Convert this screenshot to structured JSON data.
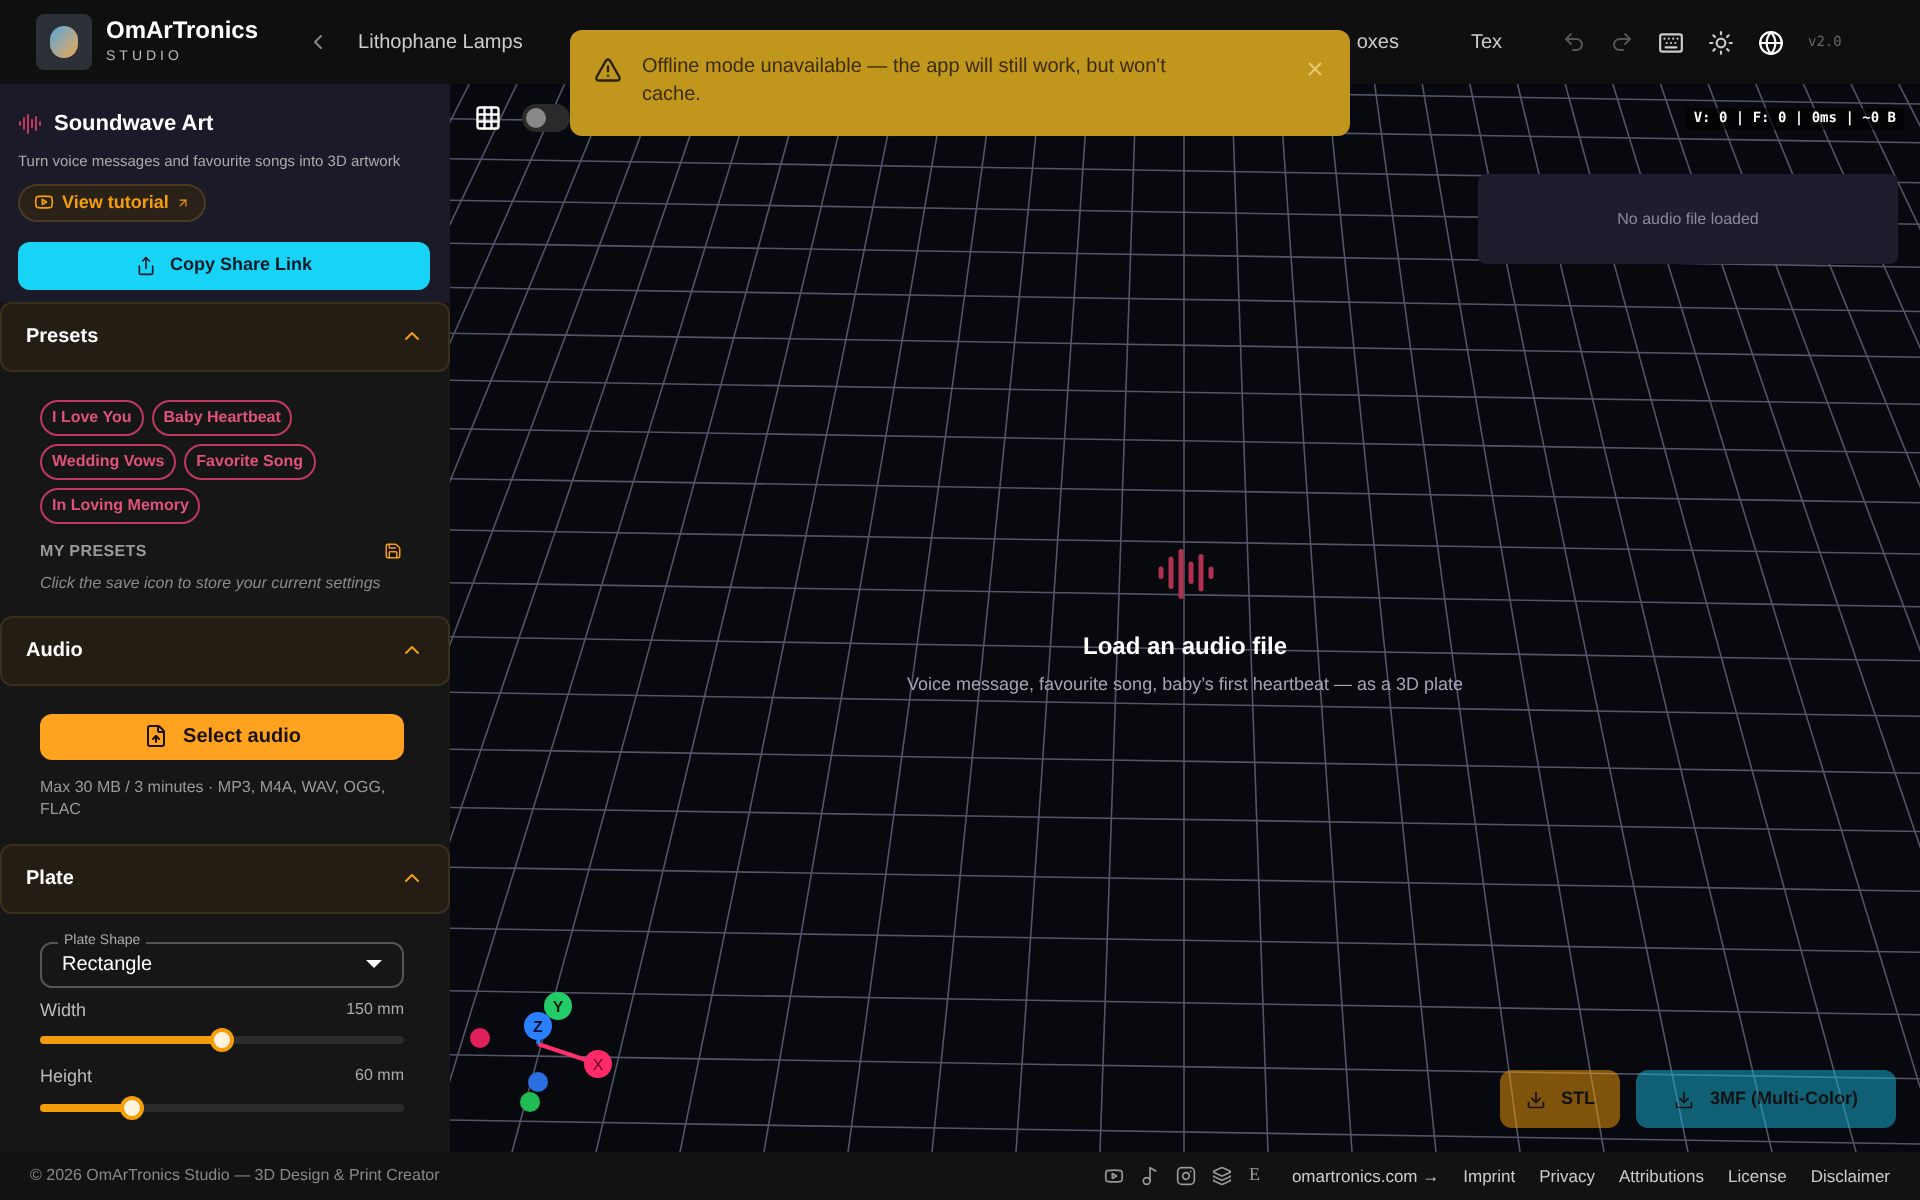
{
  "brand": {
    "name": "OmArTronics",
    "sub": "STUDIO"
  },
  "nav": {
    "tabs": [
      {
        "label": "Lithophane Lamps",
        "selected": false
      },
      {
        "label": "oxes",
        "selected": false
      },
      {
        "label": "Tex",
        "selected": false
      }
    ]
  },
  "view_toggle": {
    "on": false
  },
  "toolbar": {
    "undo_disabled": true,
    "redo_disabled": true,
    "version": "v2.0"
  },
  "toast": {
    "message": "Offline mode unavailable — the app will still work, but won't cache."
  },
  "sidebar": {
    "title": "Soundwave Art",
    "subtitle": "Turn voice messages and favourite songs into 3D artwork",
    "tutorial": "View tutorial",
    "share": "Copy Share Link",
    "sections": [
      {
        "kind": "presets",
        "title": "Presets",
        "expanded": true,
        "chips": [
          "I Love You",
          "Baby Heartbeat",
          "Wedding Vows",
          "Favorite Song",
          "In Loving Memory"
        ],
        "my_presets": "MY PRESETS",
        "hint": "Click the save icon to store your current settings"
      },
      {
        "kind": "audio",
        "title": "Audio",
        "expanded": true,
        "button": "Select audio",
        "note": "Max 30 MB / 3 minutes · MP3, M4A, WAV, OGG, FLAC"
      },
      {
        "kind": "plate",
        "title": "Plate",
        "expanded": true,
        "shape_label": "Plate Shape",
        "shape_value": "Rectangle",
        "sliders": [
          {
            "label": "Width",
            "reading": "150 mm",
            "level": 0.5
          },
          {
            "label": "Height",
            "reading": "60 mm",
            "level": 0.25
          }
        ]
      }
    ]
  },
  "viewport": {
    "stats": "V: 0 | F: 0 | 0ms | ~0 B",
    "audio_panel": "No audio file loaded",
    "empty_title": "Load an audio file",
    "empty_text": "Voice message, favourite song, baby’s first heartbeat — as a 3D plate",
    "gizmo": [
      "X",
      "Y",
      "Z"
    ],
    "exports": [
      {
        "kind": "stl",
        "label": "STL",
        "disabled": true
      },
      {
        "kind": "multicolor",
        "label": "3MF (Multi-Color)",
        "disabled": true
      }
    ]
  },
  "footer": {
    "copyright": "© 2026 OmArTronics Studio — 3D Design & Print Creator",
    "icon_letter": "E",
    "links": [
      "omartronics.com →",
      "Imprint",
      "Privacy",
      "Attributions",
      "License",
      "Disclaimer"
    ]
  }
}
